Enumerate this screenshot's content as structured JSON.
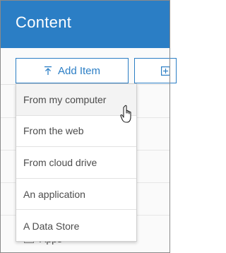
{
  "header": {
    "title": "Content"
  },
  "toolbar": {
    "add_item_label": "Add Item",
    "add_item_icon": "upload-arrow-icon",
    "second_button_icon": "add-square-icon"
  },
  "dropdown": {
    "items": [
      {
        "label": "From my computer"
      },
      {
        "label": "From the web"
      },
      {
        "label": "From cloud drive"
      },
      {
        "label": "An application"
      },
      {
        "label": "A Data Store"
      }
    ]
  },
  "background": {
    "partial_label": "Apps"
  },
  "colors": {
    "header": "#2b7ec5",
    "accent": "#2b7ec5",
    "text": "#4c4c4c"
  }
}
